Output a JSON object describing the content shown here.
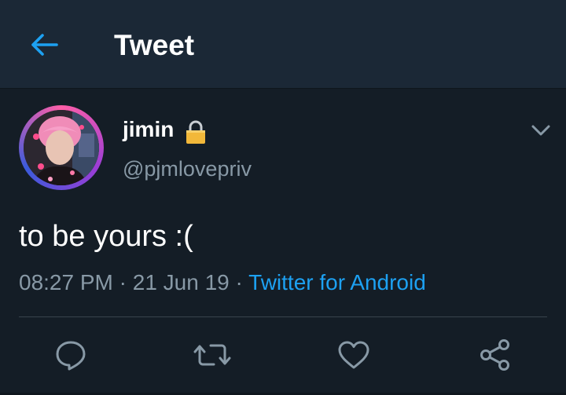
{
  "header": {
    "title": "Tweet",
    "back_icon": "back-arrow-icon",
    "accent": "#1da1f2"
  },
  "tweet": {
    "display_name": "jimin",
    "locked_icon": "lock-icon",
    "handle": "@pjmlovepriv",
    "text": "to be yours :(",
    "time": "08:27 PM",
    "separator": " · ",
    "date": "21 Jun 19",
    "source": "Twitter for Android"
  },
  "actions": [
    {
      "icon": "reply-icon"
    },
    {
      "icon": "retweet-icon"
    },
    {
      "icon": "like-icon"
    },
    {
      "icon": "share-icon"
    }
  ],
  "colors": {
    "background": "#141d26",
    "header_bg": "#1b2836",
    "secondary_text": "#8899a6",
    "link": "#1da1f2"
  }
}
